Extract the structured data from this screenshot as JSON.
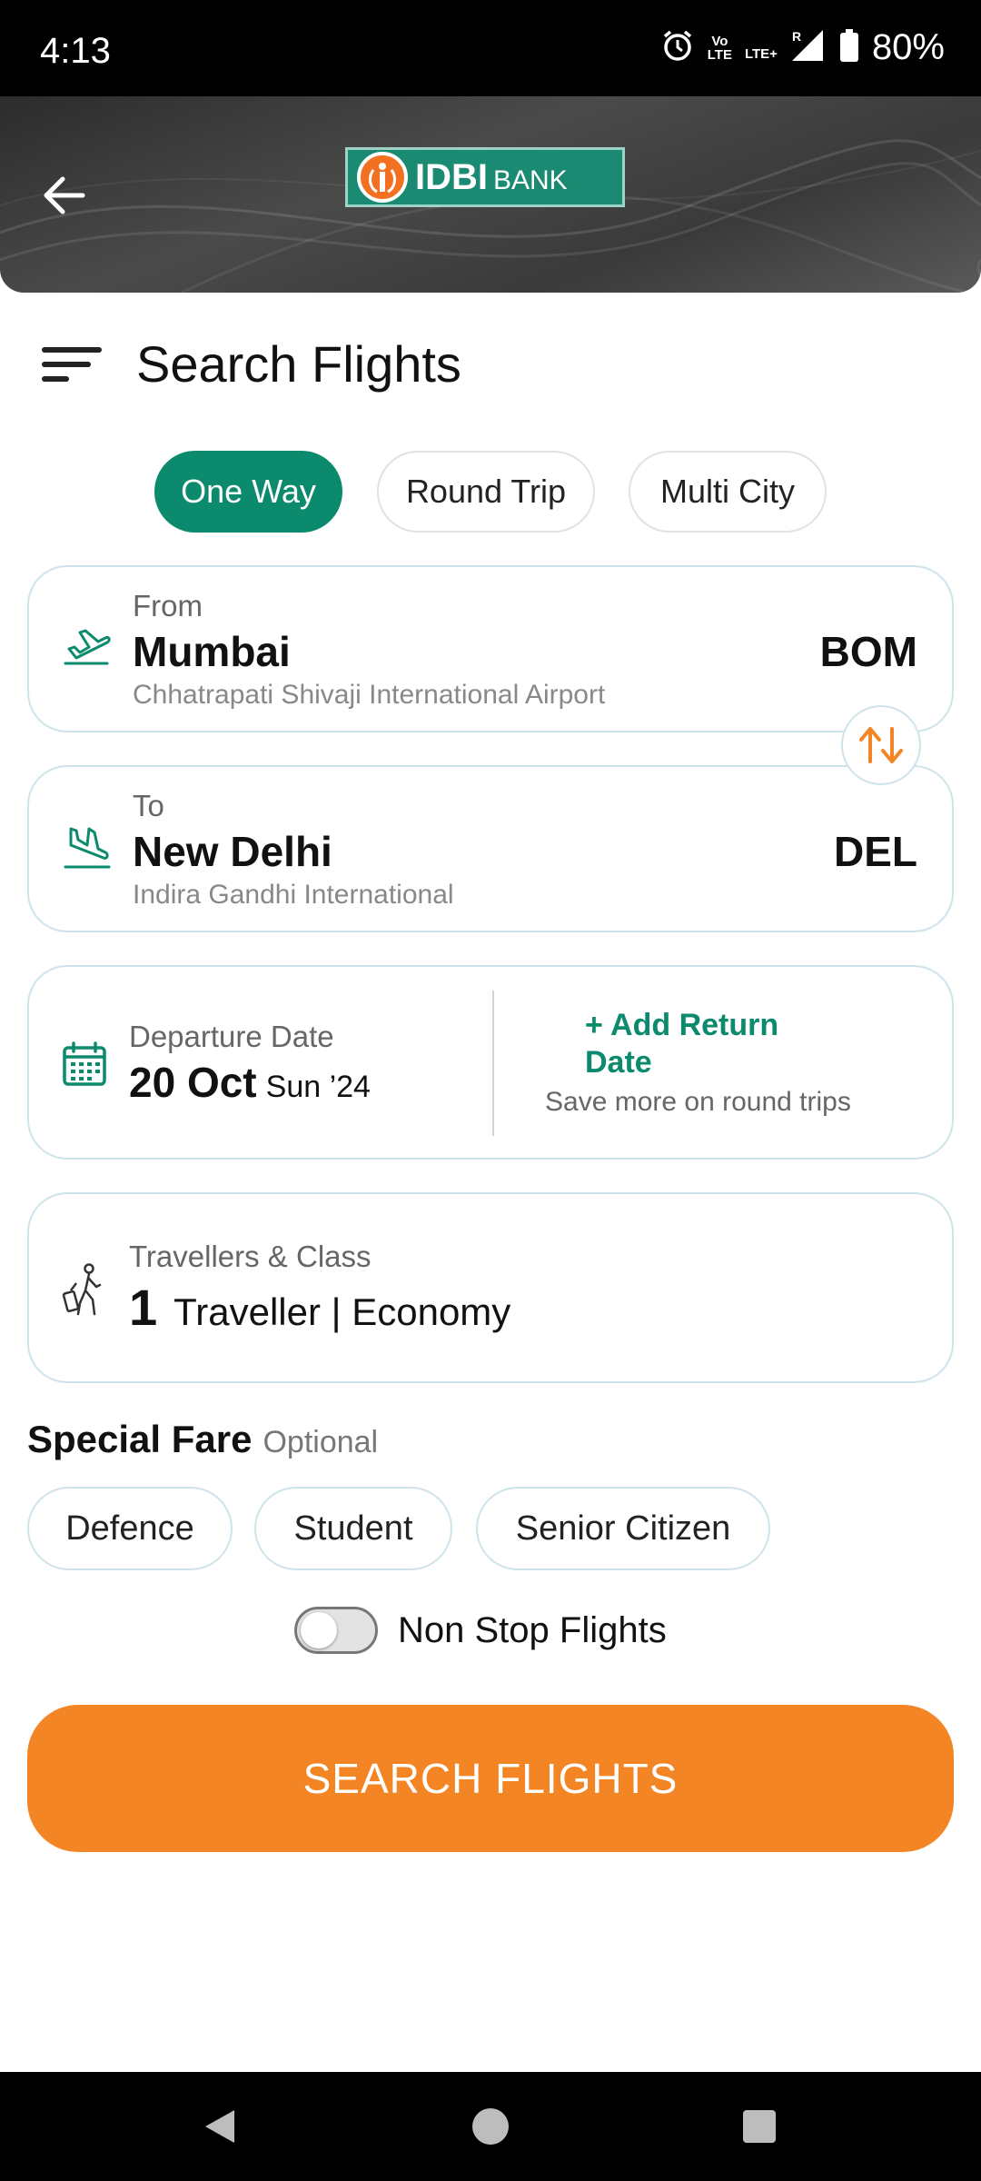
{
  "status_bar": {
    "time": "4:13",
    "volte": "Vo LTE",
    "lte": "LTE+",
    "roaming": "R",
    "battery": "80%"
  },
  "header": {
    "bank_name": "IDBI",
    "bank_suffix": "BANK",
    "brand_colors": {
      "logo_bg": "#1b8a72",
      "logo_accent": "#f37021"
    }
  },
  "page": {
    "title": "Search Flights"
  },
  "trip_types": {
    "one_way": "One Way",
    "round_trip": "Round Trip",
    "multi_city": "Multi City",
    "selected": "One Way"
  },
  "from": {
    "label": "From",
    "city": "Mumbai",
    "airport": "Chhatrapati Shivaji International Airport",
    "code": "BOM"
  },
  "to": {
    "label": "To",
    "city": "New Delhi",
    "airport": "Indira Gandhi International",
    "code": "DEL"
  },
  "dates": {
    "departure_label": "Departure Date",
    "departure_date": "20 Oct",
    "departure_day": "Sun ’24",
    "add_return": "+ Add Return Date",
    "return_hint": "Save more on round trips"
  },
  "travellers": {
    "label": "Travellers & Class",
    "count": "1",
    "summary": "Traveller | Economy"
  },
  "special_fare": {
    "title": "Special Fare",
    "optional": "Optional",
    "options": [
      "Defence",
      "Student",
      "Senior Citizen"
    ]
  },
  "non_stop": {
    "label": "Non Stop Flights",
    "enabled": false
  },
  "search_button": "SEARCH FLIGHTS",
  "colors": {
    "accent_green": "#0b8a6d",
    "accent_orange": "#f48524"
  }
}
